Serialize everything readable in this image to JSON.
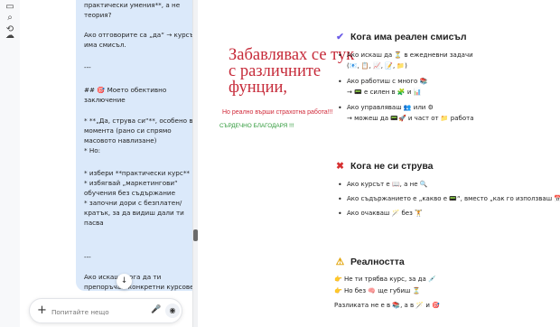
{
  "rail": {
    "icons": [
      "panel-icon",
      "search-icon",
      "new-chat-icon",
      "cloud-icon"
    ]
  },
  "chat": {
    "message_lines": [
      "практически умения**, а не теория?",
      "Ако отговорите са „да“ → курсът има смисъл.",
      "---",
      "## 🎯 Моето обективно заключение",
      "* **„Да, струва си“**, особено в момента (рано си спрямо масовото навлизане)\n* Но:",
      "  * избери **практически курс**\n  * избягвай „маркетингови“ обучения без съдържание\n  * започни дори с безплатен/кратък, за да видиш дали ти пасва",
      "---",
      "Ако искаш, мога да ти препоръчам конкретни курсове според това:"
    ],
    "scroll_down_label": "↓",
    "composer": {
      "plus": "+",
      "placeholder": "Попитайте нещо",
      "mic": "🎤",
      "voice": "◉"
    }
  },
  "doc": {
    "handwritten": {
      "title": "Забавлявах се тук с различните фунции,",
      "line1": "Но реално върши страхотна работа!!!",
      "line2": "СЪРДЕЧНО БЛАГОДАРЯ !!!"
    },
    "section1": {
      "icon": "✔",
      "icon_color": "#6c5ce7",
      "title": "Кога има реален смисъл",
      "bullets": [
        "Ако искаш да ⏳ в ежедневни задачи",
        "(📧, 📋, 📈, 📝, 📁)",
        "Ако работиш с много 📚",
        "→ 📟 е силен в 🧩 и 📊",
        "Ако управляваш 👥 или ⚙",
        "→ можеш да 📟🚀 и част от 📁 работа"
      ]
    },
    "section2": {
      "icon": "✖",
      "icon_color": "#d63031",
      "title": "Кога не си струва",
      "bullets": [
        "Ако курсът е 📖, а не 🔍",
        "Ако съдържанието е „какво е 📟“, вместо „как го използваш 📅“",
        "Ако очакваш 🪄 без 🏋"
      ]
    },
    "section3": {
      "icon": "⚠",
      "icon_color": "#e1a100",
      "title": "Реалността",
      "lines": [
        "👉 Не ти трябва курс, за да 💉",
        "👉 Но без 🧠 ще губиш ⏳",
        "Разликата не е в 📚, а в 🪄 и 🎯"
      ]
    }
  }
}
